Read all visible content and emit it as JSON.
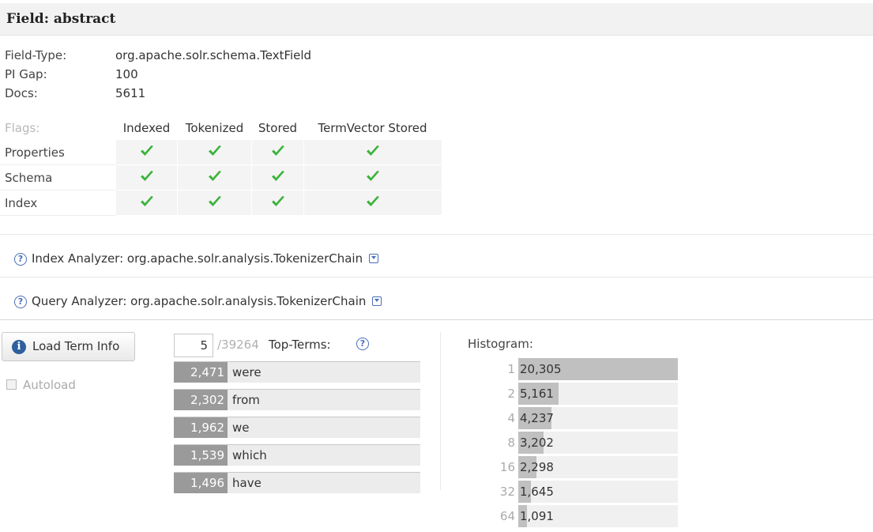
{
  "header": {
    "title": "Field: abstract"
  },
  "info": [
    {
      "label": "Field-Type:",
      "value": "org.apache.solr.schema.TextField"
    },
    {
      "label": "PI Gap:",
      "value": "100"
    },
    {
      "label": "Docs:",
      "value": "5611"
    }
  ],
  "flags": {
    "label": "Flags:",
    "columns": [
      "Indexed",
      "Tokenized",
      "Stored",
      "TermVector Stored"
    ],
    "rows": [
      {
        "label": "Properties",
        "checks": [
          true,
          true,
          true,
          true
        ]
      },
      {
        "label": "Schema",
        "checks": [
          true,
          true,
          true,
          true
        ]
      },
      {
        "label": "Index",
        "checks": [
          true,
          true,
          true,
          true
        ]
      }
    ]
  },
  "index_analyzer": {
    "text": "Index Analyzer: org.apache.solr.analysis.TokenizerChain",
    "icon": "question-icon"
  },
  "query_analyzer": {
    "text": "Query Analyzer: org.apache.solr.analysis.TokenizerChain",
    "icon": "question-icon"
  },
  "load_button": {
    "label": "Load Term Info",
    "icon": "info-icon"
  },
  "autoload": {
    "label": "Autoload",
    "checked": false
  },
  "top_terms": {
    "count": "5",
    "total": "/39264",
    "label": "Top-Terms:",
    "terms": [
      {
        "count": "2,471",
        "term": "were"
      },
      {
        "count": "2,302",
        "term": "from"
      },
      {
        "count": "1,962",
        "term": "we"
      },
      {
        "count": "1,539",
        "term": "which"
      },
      {
        "count": "1,496",
        "term": "have"
      }
    ]
  },
  "histogram": {
    "title": "Histogram:",
    "rows": [
      {
        "key": "1",
        "value": "20,305",
        "n": 20305
      },
      {
        "key": "2",
        "value": "5,161",
        "n": 5161
      },
      {
        "key": "4",
        "value": "4,237",
        "n": 4237
      },
      {
        "key": "8",
        "value": "3,202",
        "n": 3202
      },
      {
        "key": "16",
        "value": "2,298",
        "n": 2298
      },
      {
        "key": "32",
        "value": "1,645",
        "n": 1645
      },
      {
        "key": "64",
        "value": "1,091",
        "n": 1091
      }
    ]
  },
  "colors": {
    "check": "#3bb33b",
    "accent": "#4a6fb8",
    "count_bg": "#9a9a9a"
  }
}
